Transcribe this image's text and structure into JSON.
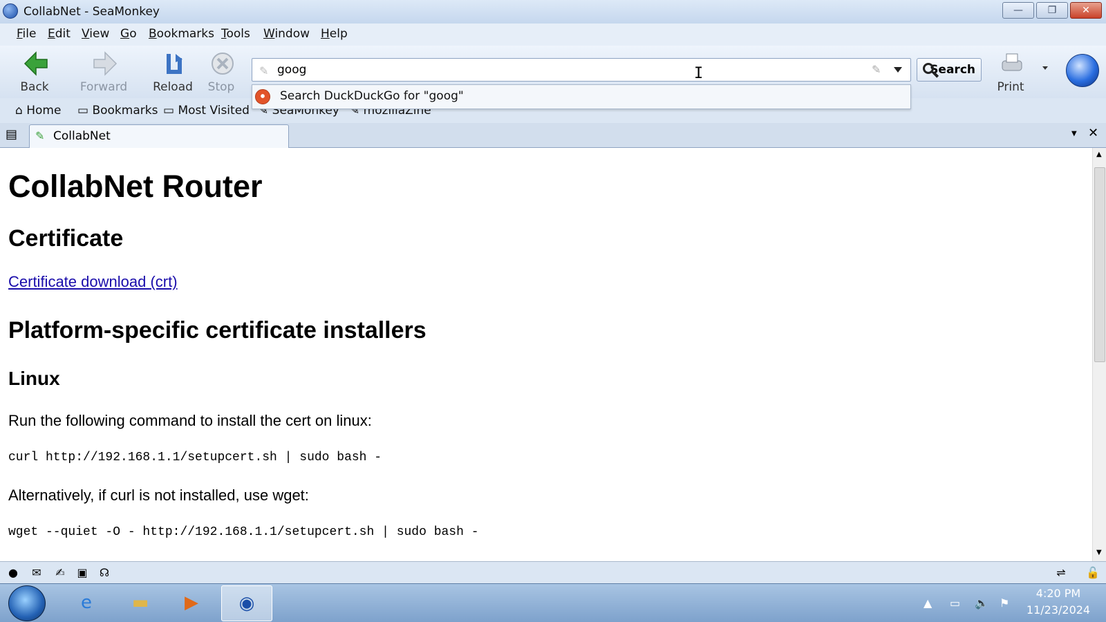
{
  "window": {
    "title": "CollabNet - SeaMonkey"
  },
  "menu": [
    "File",
    "Edit",
    "View",
    "Go",
    "Bookmarks",
    "Tools",
    "Window",
    "Help"
  ],
  "toolbar": {
    "back": "Back",
    "forward": "Forward",
    "reload": "Reload",
    "stop": "Stop",
    "print": "Print",
    "search_button": "Search"
  },
  "urlbar": {
    "value": "goog"
  },
  "autocomplete": {
    "suggestion": "Search DuckDuckGo for \"goog\""
  },
  "personal_bar": [
    "Home",
    "Bookmarks",
    "Most Visited",
    "SeaMonkey",
    "mozillaZine"
  ],
  "tab": {
    "label": "CollabNet"
  },
  "page": {
    "h1": "CollabNet Router",
    "h2_certificate": "Certificate",
    "cert_link": "Certificate download (crt)",
    "h2_installers": "Platform-specific certificate installers",
    "h3_linux": "Linux",
    "linux_instruction": "Run the following command to install the cert on linux:",
    "curl_cmd": "curl http://192.168.1.1/setupcert.sh | sudo bash -",
    "alt_instruction": "Alternatively, if curl is not installed, use wget:",
    "wget_cmd": "wget --quiet -O - http://192.168.1.1/setupcert.sh | sudo bash -"
  },
  "taskbar": {
    "time": "4:20 PM",
    "date": "11/23/2024"
  },
  "colors": {
    "link": "#1a0dab",
    "close_button": "#c9422a"
  }
}
